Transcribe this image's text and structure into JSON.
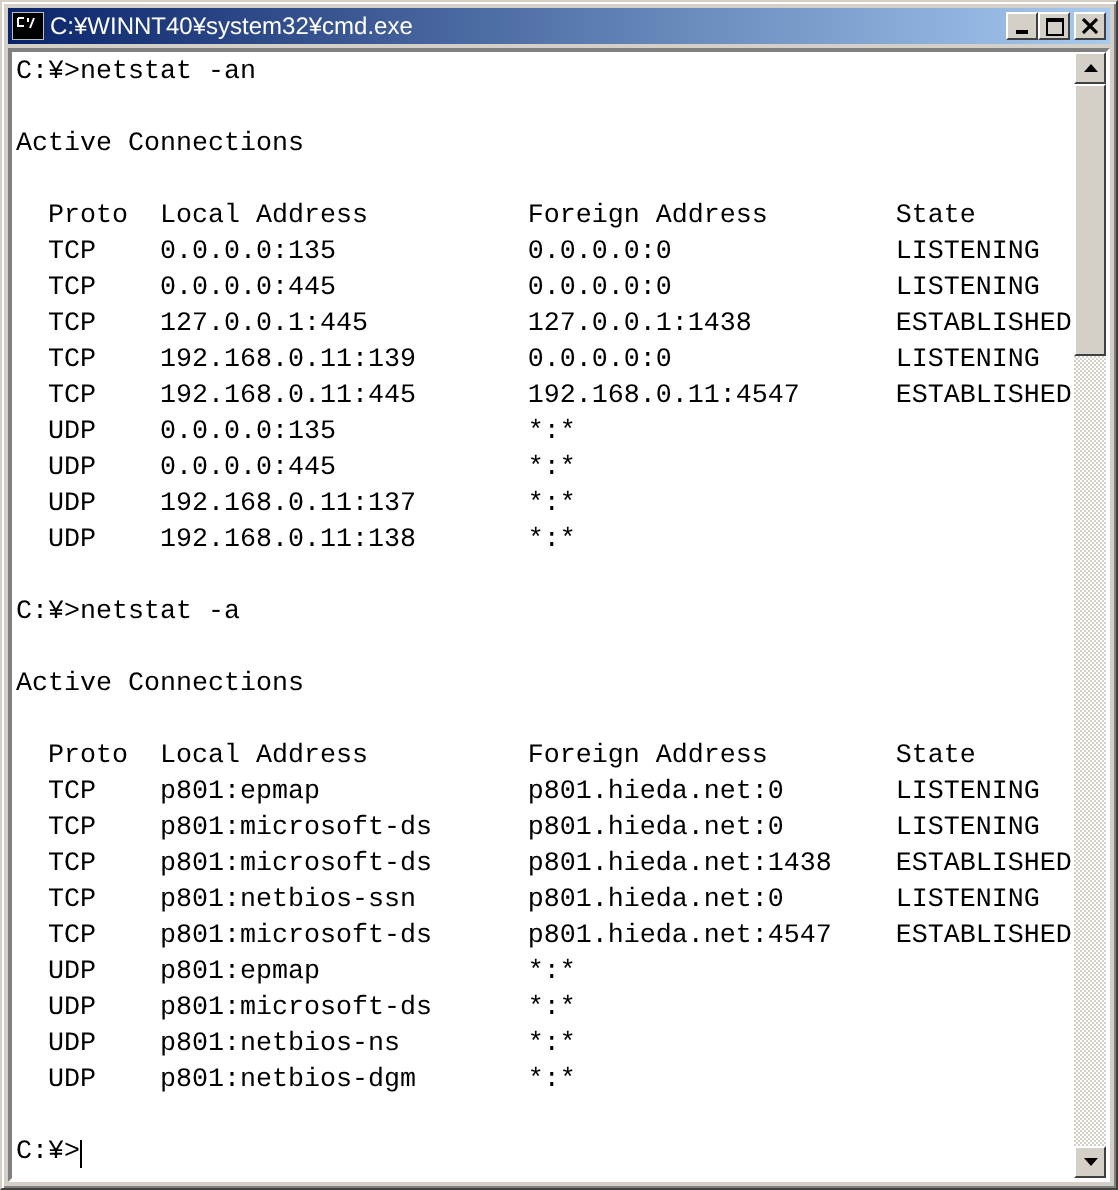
{
  "window": {
    "title": "C:¥WINNT40¥system32¥cmd.exe"
  },
  "console": {
    "blocks": [
      {
        "command": "C:¥>netstat -an",
        "heading": "Active Connections",
        "columns": [
          "Proto",
          "Local Address",
          "Foreign Address",
          "State"
        ],
        "rows": [
          [
            "TCP",
            "0.0.0.0:135",
            "0.0.0.0:0",
            "LISTENING"
          ],
          [
            "TCP",
            "0.0.0.0:445",
            "0.0.0.0:0",
            "LISTENING"
          ],
          [
            "TCP",
            "127.0.0.1:445",
            "127.0.0.1:1438",
            "ESTABLISHED"
          ],
          [
            "TCP",
            "192.168.0.11:139",
            "0.0.0.0:0",
            "LISTENING"
          ],
          [
            "TCP",
            "192.168.0.11:445",
            "192.168.0.11:4547",
            "ESTABLISHED"
          ],
          [
            "UDP",
            "0.0.0.0:135",
            "*:*"
          ],
          [
            "UDP",
            "0.0.0.0:445",
            "*:*"
          ],
          [
            "UDP",
            "192.168.0.11:137",
            "*:*"
          ],
          [
            "UDP",
            "192.168.0.11:138",
            "*:*"
          ]
        ]
      },
      {
        "command": "C:¥>netstat -a",
        "heading": "Active Connections",
        "columns": [
          "Proto",
          "Local Address",
          "Foreign Address",
          "State"
        ],
        "rows": [
          [
            "TCP",
            "p801:epmap",
            "p801.hieda.net:0",
            "LISTENING"
          ],
          [
            "TCP",
            "p801:microsoft-ds",
            "p801.hieda.net:0",
            "LISTENING"
          ],
          [
            "TCP",
            "p801:microsoft-ds",
            "p801.hieda.net:1438",
            "ESTABLISHED"
          ],
          [
            "TCP",
            "p801:netbios-ssn",
            "p801.hieda.net:0",
            "LISTENING"
          ],
          [
            "TCP",
            "p801:microsoft-ds",
            "p801.hieda.net:4547",
            "ESTABLISHED"
          ],
          [
            "UDP",
            "p801:epmap",
            "*:*"
          ],
          [
            "UDP",
            "p801:microsoft-ds",
            "*:*"
          ],
          [
            "UDP",
            "p801:netbios-ns",
            "*:*"
          ],
          [
            "UDP",
            "p801:netbios-dgm",
            "*:*"
          ]
        ]
      }
    ],
    "prompt": "C:¥>"
  }
}
